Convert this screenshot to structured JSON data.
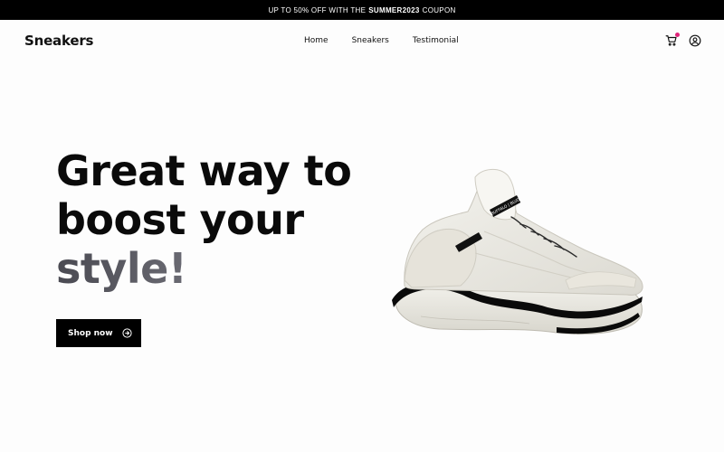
{
  "promo": {
    "prefix": "UP TO 50% OFF WITH THE",
    "code": "SUMMER2023",
    "suffix": "COUPON"
  },
  "brand": "Sneakers",
  "nav": {
    "items": [
      {
        "label": "Home"
      },
      {
        "label": "Sneakers"
      },
      {
        "label": "Testimonial"
      }
    ]
  },
  "icons": {
    "cart": "shopping-cart-icon",
    "account": "user-circle-icon",
    "cart_badge_color": "#e0257a"
  },
  "hero": {
    "line1": "Great way to",
    "line2": "boost your",
    "line3": "style!",
    "cta_label": "Shop now",
    "shoe_tag_text": "BUFFALO | BLVD"
  },
  "colors": {
    "promo_bg": "#000000",
    "accent_gradient_start": "#4a4a52",
    "accent_gradient_end": "#9a9aa3",
    "button_bg": "#000000"
  }
}
